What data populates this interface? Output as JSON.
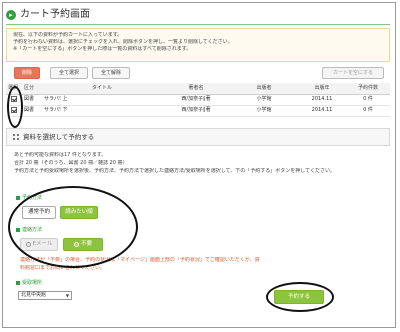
{
  "page": {
    "title": "カート予約画面",
    "title_icon": "arrow-right-icon"
  },
  "notice": {
    "lines": [
      "現在、以下の資料が予約カートに入っています。",
      "予約を行わない資料は、選択にチェックを入れ、削除ボタンを押し、一覧より削除してください。",
      "※「カートを空にする」ボタンを押した際は一覧の資料はすべて削除されます。"
    ]
  },
  "toolbar": {
    "delete_label": "削除",
    "select_all_label": "全て選択",
    "unselect_all_label": "全て解除",
    "empty_cart_label": "カートを空にする"
  },
  "table": {
    "headers": [
      "選択",
      "区分",
      "タイトル",
      "著者名",
      "出版者",
      "出版年",
      "予約件数"
    ],
    "rows": [
      {
        "checked": true,
        "kind": "図書",
        "title": "サラバ! 上",
        "author": "西/加奈子∥著",
        "publisher": "小学館",
        "year": "2014.11",
        "count": "0 件"
      },
      {
        "checked": true,
        "kind": "図書",
        "title": "サラバ! 下",
        "author": "西/加奈子∥著",
        "publisher": "小学館",
        "year": "2014.11",
        "count": "0 件"
      }
    ]
  },
  "section": {
    "title": "資料を選択して予約する"
  },
  "info": {
    "lines": [
      "あと予約可能な資料は17 件となります。",
      "合計 20 冊（そのうち、図書 20 冊／雑誌 20 冊）",
      "予約方法と予約受取場所を選択後、予約方法、予約方法で選択した連絡方法/受取場所を選択して、下の「予約する」ボタンを押してください。"
    ]
  },
  "method": {
    "label": "予約方法",
    "normal_label": "通常予約",
    "want_label": "読みたい順"
  },
  "contact": {
    "label": "連絡方法",
    "email_label": "Eメール",
    "none_label": "不要"
  },
  "warning": {
    "lines": [
      "連絡方法が「不要」の場合、予約の状況は「マイページ」画面上部の「予約状況」でご確認いただくか、資",
      "料館窓口までお問い合わせください。"
    ]
  },
  "place": {
    "label": "受取場所",
    "selected": "北見中央館"
  },
  "submit": {
    "label": "予約する"
  },
  "colors": {
    "accent_green": "#8dc43f",
    "delete_orange": "#e87757",
    "warning_orange": "#e05a2a",
    "title_green": "#2e9e3e"
  }
}
